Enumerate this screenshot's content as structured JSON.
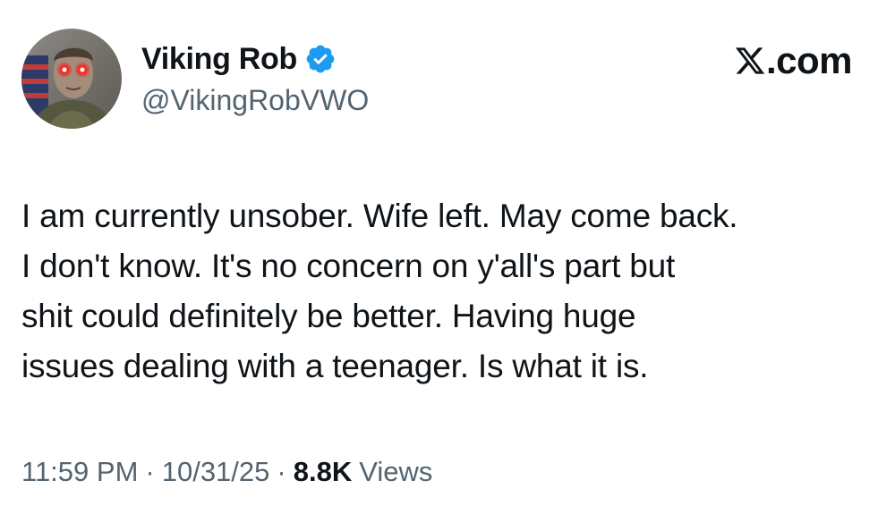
{
  "author": {
    "display_name": "Viking Rob",
    "handle": "@VikingRobVWO",
    "verified": true,
    "badge_color": "#1d9bf0"
  },
  "brand": {
    "suffix": ".com",
    "icon": "x-logo-icon"
  },
  "tweet": {
    "text": "I am currently unsober. Wife left. May come back.\nI don't know. It's no concern on y'all's part but\nshit could definitely be better. Having huge\nissues dealing with a teenager. Is what it is."
  },
  "meta": {
    "time": "11:59 PM",
    "separator": "·",
    "date": "10/31/25",
    "views_count": "8.8K",
    "views_label": "Views"
  },
  "colors": {
    "text": "#0f1419",
    "secondary": "#536471",
    "accent": "#1d9bf0"
  }
}
